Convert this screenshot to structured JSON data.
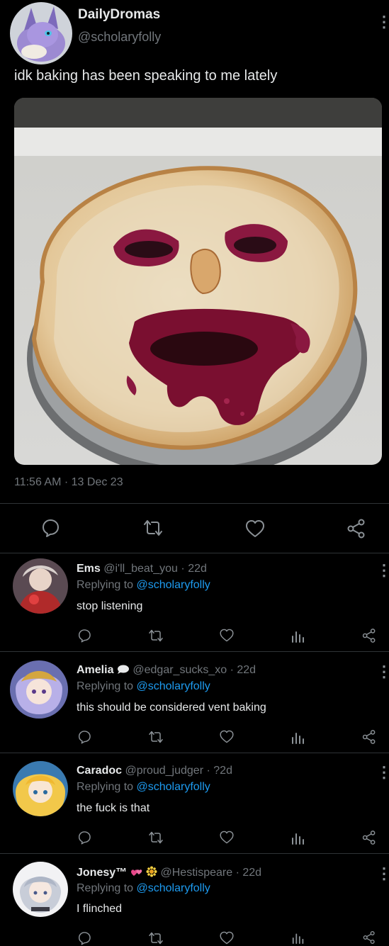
{
  "tweet": {
    "display_name": "DailyDromas",
    "handle": "@scholaryfolly",
    "text": "idk baking has been speaking to me lately",
    "time": "11:56 AM",
    "date": "13 Dec 23",
    "separator": "·",
    "more": "⋮"
  },
  "replies": [
    {
      "name": "Ems",
      "handle": "@i'll_beat_you",
      "age": "22d",
      "replying_prefix": "Replying to",
      "replying_handle": "@scholaryfolly",
      "text": "stop listening"
    },
    {
      "name": "Amelia",
      "handle": "@edgar_sucks_xo",
      "age": "22d",
      "replying_prefix": "Replying to",
      "replying_handle": "@scholaryfolly",
      "text": "this should be considered vent baking"
    },
    {
      "name": "Caradoc",
      "handle": "@proud_judger",
      "age": "?2d",
      "replying_prefix": "Replying to",
      "replying_handle": "@scholaryfolly",
      "text": "the fuck is that"
    },
    {
      "name": "Jonesy™",
      "handle": "@Hestispeare",
      "age": "22d",
      "replying_prefix": "Replying to",
      "replying_handle": "@scholaryfolly",
      "text": "I flinched"
    }
  ],
  "icons": [
    "reply-icon",
    "retweet-icon",
    "like-icon",
    "analytics-icon",
    "share-icon",
    "more-icon"
  ],
  "colors": {
    "background": "#000000",
    "link": "#1d9bf0",
    "muted": "#71767b",
    "divider": "#2f3336",
    "berry": "#6a1030"
  }
}
